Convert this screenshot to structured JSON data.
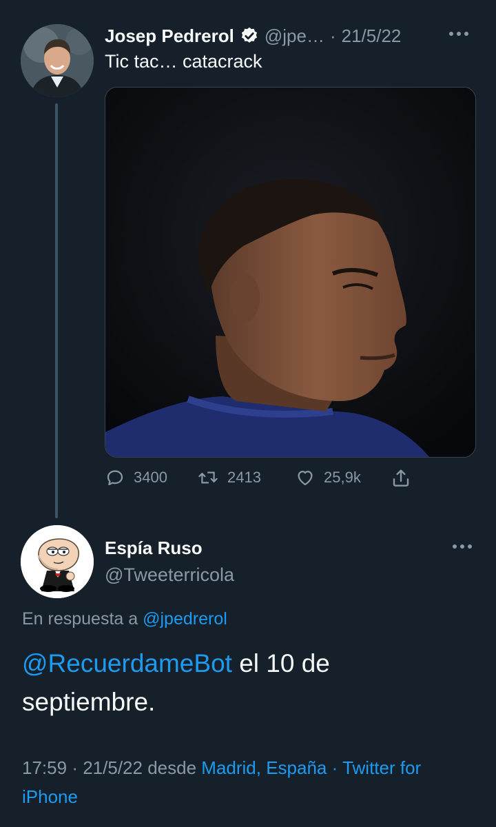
{
  "tweet": {
    "author_name": "Josep Pedrerol",
    "author_handle": "@jpe…",
    "separator": "·",
    "date": "21/5/22",
    "text": "Tic tac… catacrack",
    "stats": {
      "replies": "3400",
      "retweets": "2413",
      "likes": "25,9k"
    }
  },
  "reply": {
    "author_name": "Espía Ruso",
    "author_handle": "@Tweeterricola",
    "in_reply_prefix": "En respuesta a",
    "in_reply_handle": "@jpedrerol",
    "mention": "@RecuerdameBot",
    "text_rest": " el 10 de septiembre.",
    "time": "17:59",
    "date": "21/5/22",
    "from_label": "desde",
    "location": "Madrid, España",
    "separator": "·",
    "client": "Twitter for iPhone"
  },
  "colors": {
    "background": "#15202b",
    "text": "#f7f9f9",
    "secondary": "#8b98a5",
    "link": "#1d9bf0",
    "verified": "#f7f9f9"
  }
}
